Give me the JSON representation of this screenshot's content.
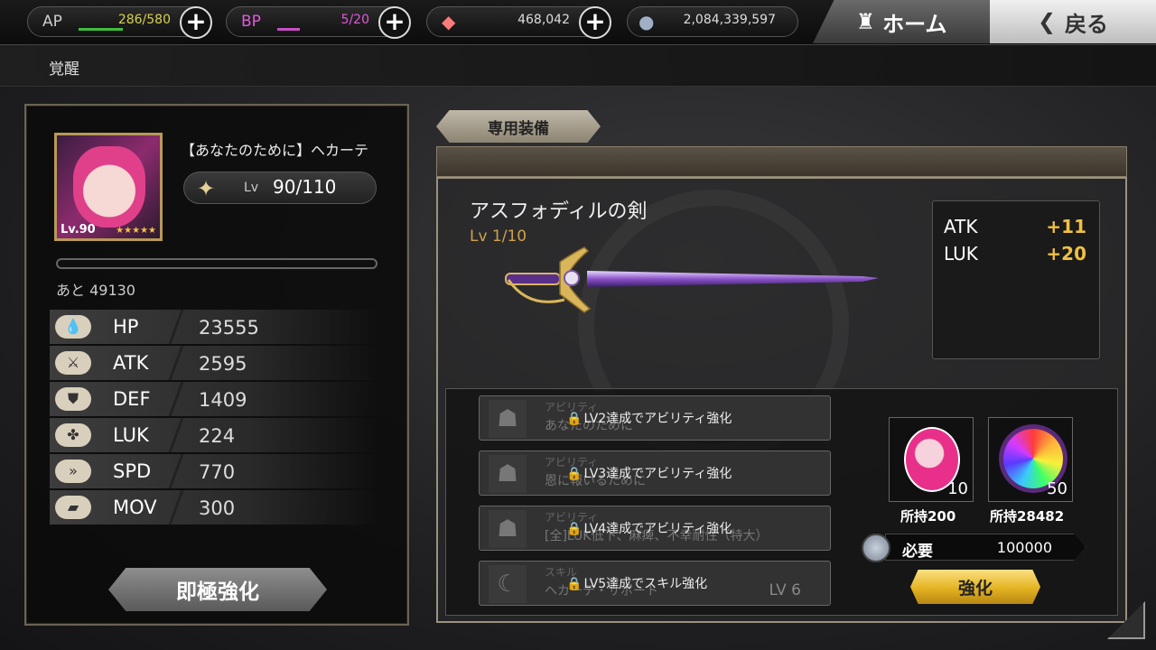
{
  "topbar": {
    "ap": {
      "label": "AP",
      "value": "286/580",
      "fill": 0.493
    },
    "bp": {
      "label": "BP",
      "value": "5/20",
      "fill": 0.25
    },
    "crystal": {
      "value": "468,042"
    },
    "coins": {
      "value": "2,084,339,597"
    },
    "home_label": "ホーム",
    "back_label": "戻る"
  },
  "page_title": "覚醒",
  "character": {
    "name": "【あなたのために】ヘカーテ",
    "portrait_level": "Lv.90",
    "stars": "★★★★★",
    "lv_prefix": "Lv",
    "level": "90/110",
    "remaining": "あと 49130",
    "stats": [
      {
        "name": "HP",
        "value": "23555",
        "icon": "drop-icon"
      },
      {
        "name": "ATK",
        "value": "2595",
        "icon": "sword-icon"
      },
      {
        "name": "DEF",
        "value": "1409",
        "icon": "shield-icon"
      },
      {
        "name": "LUK",
        "value": "224",
        "icon": "clover-icon"
      },
      {
        "name": "SPD",
        "value": "770",
        "icon": "speed-icon"
      },
      {
        "name": "MOV",
        "value": "300",
        "icon": "boot-icon"
      }
    ],
    "instant_button": "即極強化"
  },
  "equipment": {
    "tab_label": "専用装備",
    "weapon_name": "アスフォディルの剣",
    "weapon_level": "Lv  1/10",
    "bonuses": [
      {
        "stat": "ATK",
        "value": "+11"
      },
      {
        "stat": "LUK",
        "value": "+20"
      }
    ],
    "abilities": [
      {
        "type": "アビリティ",
        "desc": "あなたのために",
        "lock": "LV2達成でアビリティ強化",
        "lv": ""
      },
      {
        "type": "アビリティ",
        "desc": "恩に報いるために",
        "lock": "LV3達成でアビリティ強化",
        "lv": ""
      },
      {
        "type": "アビリティ",
        "desc": "[全]LUK低下、麻痺、不幸耐性（特大）",
        "lock": "LV4達成でアビリティ強化",
        "lv": ""
      },
      {
        "type": "スキル",
        "desc": "ヘカーテ・サポート",
        "lock": "LV5達成でスキル強化",
        "lv": "LV 6"
      }
    ],
    "materials": [
      {
        "count": "10",
        "owned": "所持200"
      },
      {
        "count": "50",
        "owned": "所持28482"
      }
    ],
    "required_label": "必要",
    "required_value": "100000",
    "enhance_button": "強化"
  }
}
